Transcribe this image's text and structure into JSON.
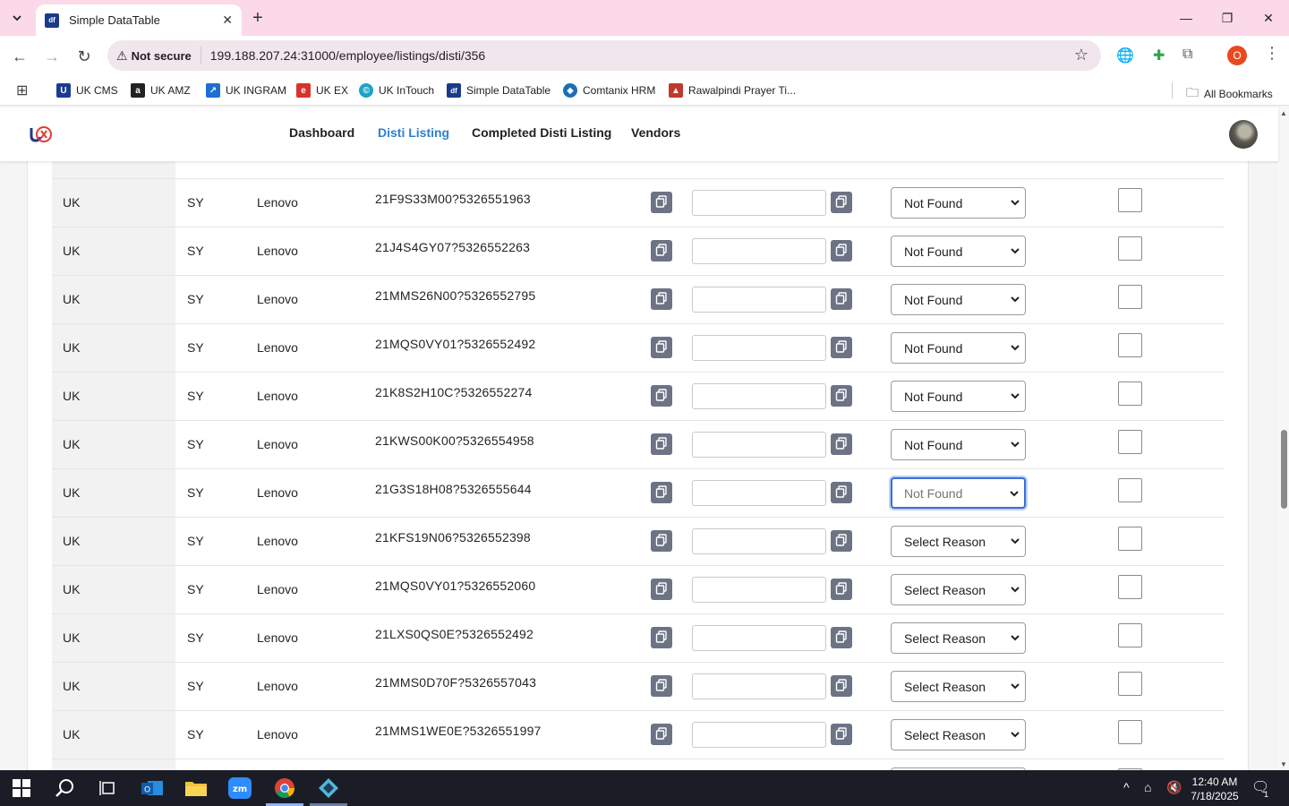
{
  "browser": {
    "tab_title": "Simple DataTable",
    "not_secure": "Not secure",
    "url": "199.188.207.24:31000/employee/listings/disti/356",
    "profile_initial": "O",
    "bookmarks": [
      {
        "label": "UK CMS",
        "color": "#1a3e8f",
        "glyph": "U"
      },
      {
        "label": "UK AMZ",
        "color": "#222222",
        "glyph": "a"
      },
      {
        "label": "UK INGRAM",
        "color": "#1d6fd1",
        "glyph": "↗"
      },
      {
        "label": "UK EX",
        "color": "#d9322b",
        "glyph": "e"
      },
      {
        "label": "UK InTouch",
        "color": "#1aa3c9",
        "glyph": "©"
      },
      {
        "label": "Simple DataTable",
        "color": "#1b3a8c",
        "glyph": "df"
      },
      {
        "label": "Comtanix HRM",
        "color": "#1c6fb5",
        "glyph": "◆"
      },
      {
        "label": "Rawalpindi Prayer Ti...",
        "color": "#c0392b",
        "glyph": "▲"
      }
    ],
    "all_bookmarks": "All Bookmarks"
  },
  "header": {
    "nav": [
      "Dashboard",
      "Disti Listing",
      "Completed Disti Listing",
      "Vendors"
    ],
    "active": "Disti Listing"
  },
  "table": {
    "rows": [
      {
        "country": "UK",
        "code": "SY",
        "vendor": "Lenovo",
        "part": "21F9S33M00?5326551963",
        "reason": "Not Found"
      },
      {
        "country": "UK",
        "code": "SY",
        "vendor": "Lenovo",
        "part": "21J4S4GY07?5326552263",
        "reason": "Not Found"
      },
      {
        "country": "UK",
        "code": "SY",
        "vendor": "Lenovo",
        "part": "21MMS26N00?5326552795",
        "reason": "Not Found"
      },
      {
        "country": "UK",
        "code": "SY",
        "vendor": "Lenovo",
        "part": "21MQS0VY01?5326552492",
        "reason": "Not Found"
      },
      {
        "country": "UK",
        "code": "SY",
        "vendor": "Lenovo",
        "part": "21K8S2H10C?5326552274",
        "reason": "Not Found"
      },
      {
        "country": "UK",
        "code": "SY",
        "vendor": "Lenovo",
        "part": "21KWS00K00?5326554958",
        "reason": "Not Found"
      },
      {
        "country": "UK",
        "code": "SY",
        "vendor": "Lenovo",
        "part": "21G3S18H08?5326555644",
        "reason": "Not Found",
        "focused": true
      },
      {
        "country": "UK",
        "code": "SY",
        "vendor": "Lenovo",
        "part": "21KFS19N06?5326552398",
        "reason": "Select Reason"
      },
      {
        "country": "UK",
        "code": "SY",
        "vendor": "Lenovo",
        "part": "21MQS0VY01?5326552060",
        "reason": "Select Reason"
      },
      {
        "country": "UK",
        "code": "SY",
        "vendor": "Lenovo",
        "part": "21LXS0QS0E?5326552492",
        "reason": "Select Reason"
      },
      {
        "country": "UK",
        "code": "SY",
        "vendor": "Lenovo",
        "part": "21MMS0D70F?5326557043",
        "reason": "Select Reason"
      },
      {
        "country": "UK",
        "code": "SY",
        "vendor": "Lenovo",
        "part": "21MMS1WE0E?5326551997",
        "reason": "Select Reason"
      }
    ]
  },
  "taskbar": {
    "time": "12:40 AM",
    "date": "7/18/2025",
    "notification_count": "1"
  }
}
